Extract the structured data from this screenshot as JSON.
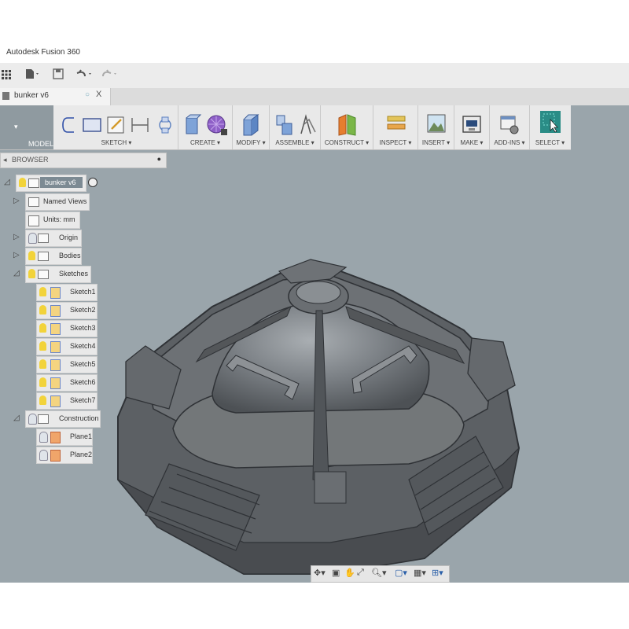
{
  "window": {
    "title": "Autodesk Fusion 360"
  },
  "quick_access": {
    "icons": [
      "grid-icon",
      "file-icon",
      "save-icon",
      "undo-icon",
      "redo-icon"
    ]
  },
  "document_tab": {
    "label": "bunker v6",
    "close": "X"
  },
  "workspace": {
    "label": "MODEL"
  },
  "ribbon": {
    "groups": [
      {
        "label": "SKETCH ▾"
      },
      {
        "label": "CREATE ▾"
      },
      {
        "label": "MODIFY ▾"
      },
      {
        "label": "ASSEMBLE ▾"
      },
      {
        "label": "CONSTRUCT ▾"
      },
      {
        "label": "INSPECT ▾"
      },
      {
        "label": "INSERT ▾"
      },
      {
        "label": "MAKE ▾"
      },
      {
        "label": "ADD-INS ▾"
      },
      {
        "label": "SELECT ▾"
      }
    ]
  },
  "browser": {
    "title": "BROWSER",
    "root": "bunker v6",
    "items": [
      {
        "label": "Named Views"
      },
      {
        "label": "Units: mm"
      },
      {
        "label": "Origin"
      },
      {
        "label": "Bodies"
      },
      {
        "label": "Sketches"
      },
      {
        "label": "Sketch1"
      },
      {
        "label": "Sketch2"
      },
      {
        "label": "Sketch3"
      },
      {
        "label": "Sketch4"
      },
      {
        "label": "Sketch5"
      },
      {
        "label": "Sketch6"
      },
      {
        "label": "Sketch7"
      },
      {
        "label": "Construction"
      },
      {
        "label": "Plane1"
      },
      {
        "label": "Plane2"
      }
    ]
  },
  "colors": {
    "viewport": "#9aa5ab",
    "ribbon": "#e9e9e9",
    "model_body": "#5f6366",
    "select_accent": "#2a8c86"
  }
}
